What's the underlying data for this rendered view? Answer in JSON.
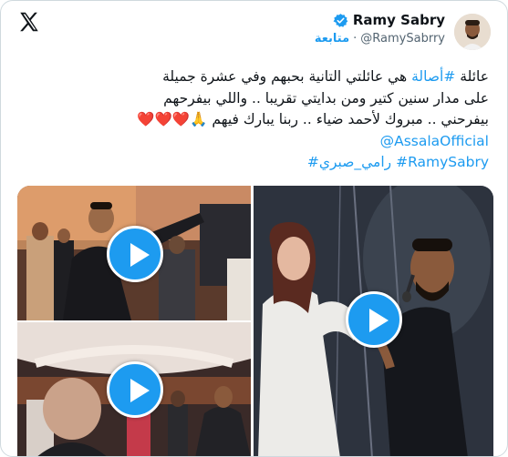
{
  "author": {
    "display_name": "Ramy Sabry",
    "handle": "@RamySabrry",
    "separator": "·",
    "follow_label": "متابعة",
    "verified_icon": "verified-badge-icon",
    "colors": {
      "accent": "#1d9bf0",
      "text": "#0f1419",
      "muted": "#536471"
    }
  },
  "tweet": {
    "line1_prefix": "عائلة",
    "line1_hashtag": "#أصالة",
    "line1_rest": "هي عائلتي التانية بحبهم وفي عشرة جميلة",
    "line2": "على مدار سنين كتير ومن بدايتي تقريبا .. واللي بيفرحهم",
    "line3": "بيفرحني .. مبروك لأحمد ضياء .. ربنا يبارك فيهم",
    "line3_emoji": "🙏❤️❤️❤️",
    "mention": "@AssalaOfficial",
    "hashtag_ar": "#رامي_صبري",
    "hashtag_en": "#RamySabry"
  },
  "media": {
    "videos": [
      {
        "id": "video-top-left",
        "icon": "play-icon"
      },
      {
        "id": "video-bottom-left",
        "icon": "play-icon"
      },
      {
        "id": "video-right",
        "icon": "play-icon"
      }
    ]
  }
}
